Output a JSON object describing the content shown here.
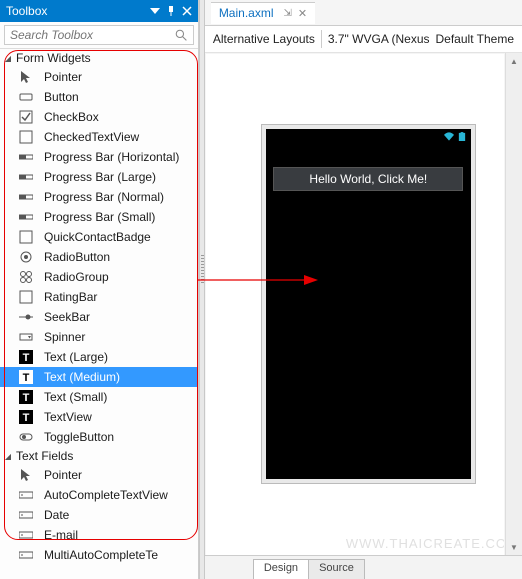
{
  "toolbox": {
    "title": "Toolbox",
    "search_placeholder": "Search Toolbox",
    "categories": [
      {
        "label": "Form Widgets",
        "expanded": true,
        "items": [
          {
            "icon": "pointer",
            "label": "Pointer"
          },
          {
            "icon": "button",
            "label": "Button"
          },
          {
            "icon": "checkbox",
            "label": "CheckBox"
          },
          {
            "icon": "square",
            "label": "CheckedTextView"
          },
          {
            "icon": "progress",
            "label": "Progress Bar (Horizontal)"
          },
          {
            "icon": "progress",
            "label": "Progress Bar (Large)"
          },
          {
            "icon": "progress",
            "label": "Progress Bar (Normal)"
          },
          {
            "icon": "progress",
            "label": "Progress Bar (Small)"
          },
          {
            "icon": "square",
            "label": "QuickContactBadge"
          },
          {
            "icon": "radio",
            "label": "RadioButton"
          },
          {
            "icon": "radiogrp",
            "label": "RadioGroup"
          },
          {
            "icon": "square",
            "label": "RatingBar"
          },
          {
            "icon": "seekbar",
            "label": "SeekBar"
          },
          {
            "icon": "spinner",
            "label": "Spinner"
          },
          {
            "icon": "text",
            "label": "Text (Large)"
          },
          {
            "icon": "text",
            "label": "Text (Medium)",
            "selected": true
          },
          {
            "icon": "text",
            "label": "Text (Small)"
          },
          {
            "icon": "text",
            "label": "TextView"
          },
          {
            "icon": "toggle",
            "label": "ToggleButton"
          }
        ]
      },
      {
        "label": "Text Fields",
        "expanded": true,
        "items": [
          {
            "icon": "pointer",
            "label": "Pointer"
          },
          {
            "icon": "input",
            "label": "AutoCompleteTextView"
          },
          {
            "icon": "input",
            "label": "Date"
          },
          {
            "icon": "input",
            "label": "E-mail"
          },
          {
            "icon": "input",
            "label": "MultiAutoCompleteTe"
          }
        ]
      }
    ]
  },
  "designer": {
    "tab_label": "Main.axml",
    "toolbar": {
      "alt_layouts": "Alternative Layouts",
      "device": "3.7\" WVGA (Nexus",
      "theme": "Default Theme"
    },
    "preview_button": "Hello World, Click Me!",
    "bottom_tabs": {
      "design": "Design",
      "source": "Source"
    }
  },
  "watermark": "WWW.THAICREATE.COM"
}
